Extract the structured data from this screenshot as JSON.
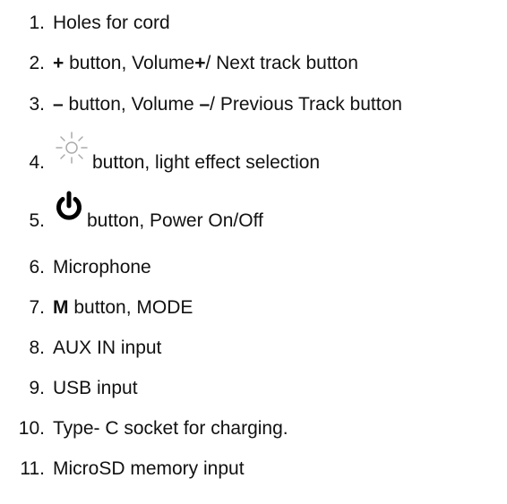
{
  "items": [
    {
      "number": "1.",
      "text": "Holes for cord"
    },
    {
      "number": "2.",
      "symbol": "+",
      "text": " button, Volume",
      "symbol2": "+",
      "text2": "/ Next track button"
    },
    {
      "number": "3.",
      "symbol": "–",
      "text": " button, Volume ",
      "symbol2": "–",
      "text2": "/ Previous Track button"
    },
    {
      "number": "4.",
      "icon": "sun-light-icon",
      "text": " button, light effect selection"
    },
    {
      "number": "5.",
      "icon": "power-icon",
      "text": " button, Power On/Off"
    },
    {
      "number": "6.",
      "text": "Microphone"
    },
    {
      "number": "7.",
      "symbol": "M",
      "text": " button, MODE"
    },
    {
      "number": "8.",
      "text": "AUX IN input"
    },
    {
      "number": "9.",
      "text": "USB input"
    },
    {
      "number": "10.",
      "text": "Type- C socket for charging."
    },
    {
      "number": "11.",
      "text": "MicroSD memory input"
    }
  ]
}
